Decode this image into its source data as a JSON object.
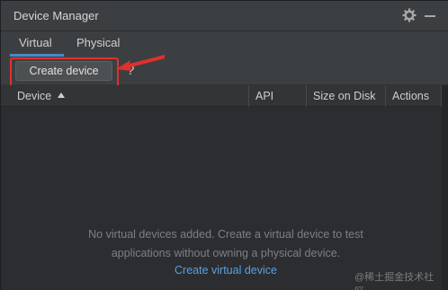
{
  "window": {
    "title": "Device Manager"
  },
  "tabs": [
    {
      "label": "Virtual"
    },
    {
      "label": "Physical"
    }
  ],
  "toolbar": {
    "create_label": "Create device",
    "help_label": "?"
  },
  "table": {
    "columns": [
      "Device",
      "API",
      "Size on Disk",
      "Actions"
    ]
  },
  "empty_state": {
    "line1": "No virtual devices added. Create a virtual device to test",
    "line2": "applications without owning a physical device.",
    "link": "Create virtual device"
  },
  "watermark": "@稀土掘金技术社区",
  "colors": {
    "accent": "#4a88c7",
    "highlight": "#e0302e",
    "link": "#5c9fe0"
  },
  "icons": {
    "settings": "gear-icon",
    "minimize": "minimize-icon",
    "sort": "sort-ascending-icon",
    "annotation": "red-arrow-icon"
  }
}
